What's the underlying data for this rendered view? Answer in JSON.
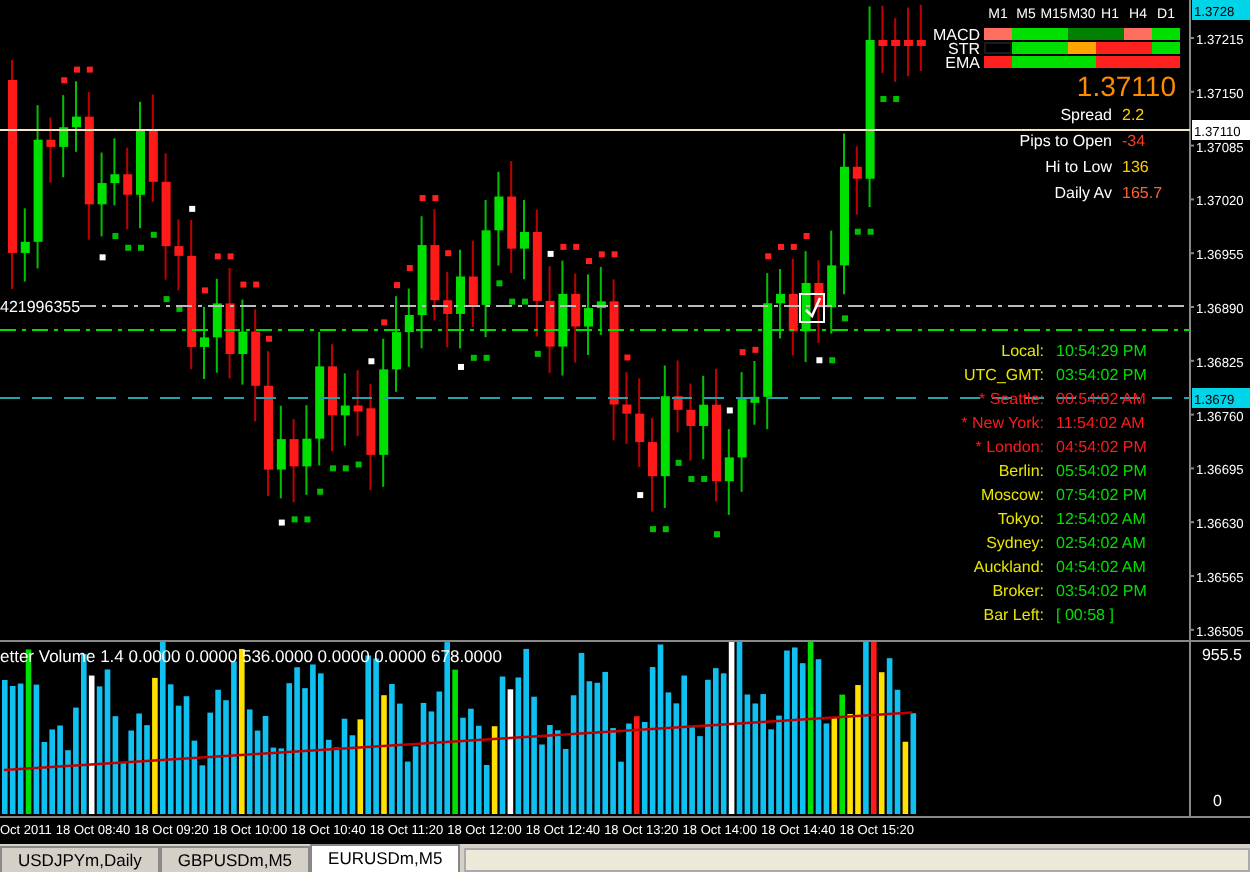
{
  "price_axis": {
    "top_label": "1.3728",
    "labels": [
      "1.37215",
      "1.37150",
      "1.37085",
      "1.37020",
      "1.36955",
      "1.36890",
      "1.36825",
      "1.36760",
      "1.36695",
      "1.36630",
      "1.36565",
      "1.36505"
    ],
    "current_price": "1.37110",
    "marker_price": "1.3679"
  },
  "level_label": "421996355",
  "timeframes": [
    "M1",
    "M5",
    "M15",
    "M30",
    "H1",
    "H4",
    "D1"
  ],
  "signals": [
    {
      "name": "MACD",
      "cells": [
        {
          "color": "#ff6f5f"
        },
        {
          "color": "#00e000"
        },
        {
          "color": "#00e000"
        },
        {
          "color": "#008000"
        },
        {
          "color": "#008000"
        },
        {
          "color": "#ff6f5f"
        },
        {
          "color": "#00e000"
        }
      ]
    },
    {
      "name": "STR",
      "cells": [
        {
          "kind": "blank"
        },
        {
          "color": "#00e000"
        },
        {
          "color": "#00e000"
        },
        {
          "color": "#ffa500"
        },
        {
          "color": "#ff2020"
        },
        {
          "color": "#ff2020"
        },
        {
          "color": "#00e000"
        }
      ]
    },
    {
      "name": "EMA",
      "cells": [
        {
          "color": "#ff2020"
        },
        {
          "color": "#00e000"
        },
        {
          "color": "#00e000"
        },
        {
          "color": "#00e000"
        },
        {
          "color": "#ff2020"
        },
        {
          "color": "#ff2020"
        },
        {
          "color": "#ff2020"
        }
      ]
    }
  ],
  "price": "1.37110",
  "stats": [
    {
      "label": "Spread",
      "value": "2.2",
      "color": "#ffcc00"
    },
    {
      "label": "Pips to Open",
      "value": "-34",
      "color": "#ff4020"
    },
    {
      "label": "Hi to Low",
      "value": "136",
      "color": "#ffcc00"
    },
    {
      "label": "Daily Av",
      "value": "165.7",
      "color": "#ff6030"
    }
  ],
  "clocks": [
    {
      "label": "Local:",
      "time": "10:54:29 PM",
      "marked": false
    },
    {
      "label": "UTC_GMT:",
      "time": "03:54:02 PM",
      "marked": false
    },
    {
      "label": "* Seattle:",
      "time": "00:54:02 AM",
      "marked": true
    },
    {
      "label": "* New York:",
      "time": "11:54:02 AM",
      "marked": true
    },
    {
      "label": "* London:",
      "time": "04:54:02 PM",
      "marked": true
    },
    {
      "label": "Berlin:",
      "time": "05:54:02 PM",
      "marked": false
    },
    {
      "label": "Moscow:",
      "time": "07:54:02 PM",
      "marked": false
    },
    {
      "label": "Tokyo:",
      "time": "12:54:02 AM",
      "marked": false
    },
    {
      "label": "Sydney:",
      "time": "02:54:02 AM",
      "marked": false
    },
    {
      "label": "Auckland:",
      "time": "04:54:02 AM",
      "marked": false
    },
    {
      "label": "Broker:",
      "time": "03:54:02 PM",
      "marked": false
    }
  ],
  "bar_left": {
    "label": "Bar Left:",
    "value": "[ 00:58 ]"
  },
  "indicator": {
    "title": "etter Volume 1.4 0.0000 0.0000 536.0000 0.0000 0.0000 678.0000",
    "max": "955.5",
    "min": "0"
  },
  "time_axis": [
    "Oct 2011",
    "18 Oct 08:40",
    "18 Oct 09:20",
    "18 Oct 10:00",
    "18 Oct 10:40",
    "18 Oct 11:20",
    "18 Oct 12:00",
    "18 Oct 12:40",
    "18 Oct 13:20",
    "18 Oct 14:00",
    "18 Oct 14:40",
    "18 Oct 15:20"
  ],
  "tabs": [
    {
      "label": "USDJPYm,Daily",
      "selected": false
    },
    {
      "label": "GBPUSDm,M5",
      "selected": false
    },
    {
      "label": "EURUSDm,M5",
      "selected": true
    }
  ]
}
